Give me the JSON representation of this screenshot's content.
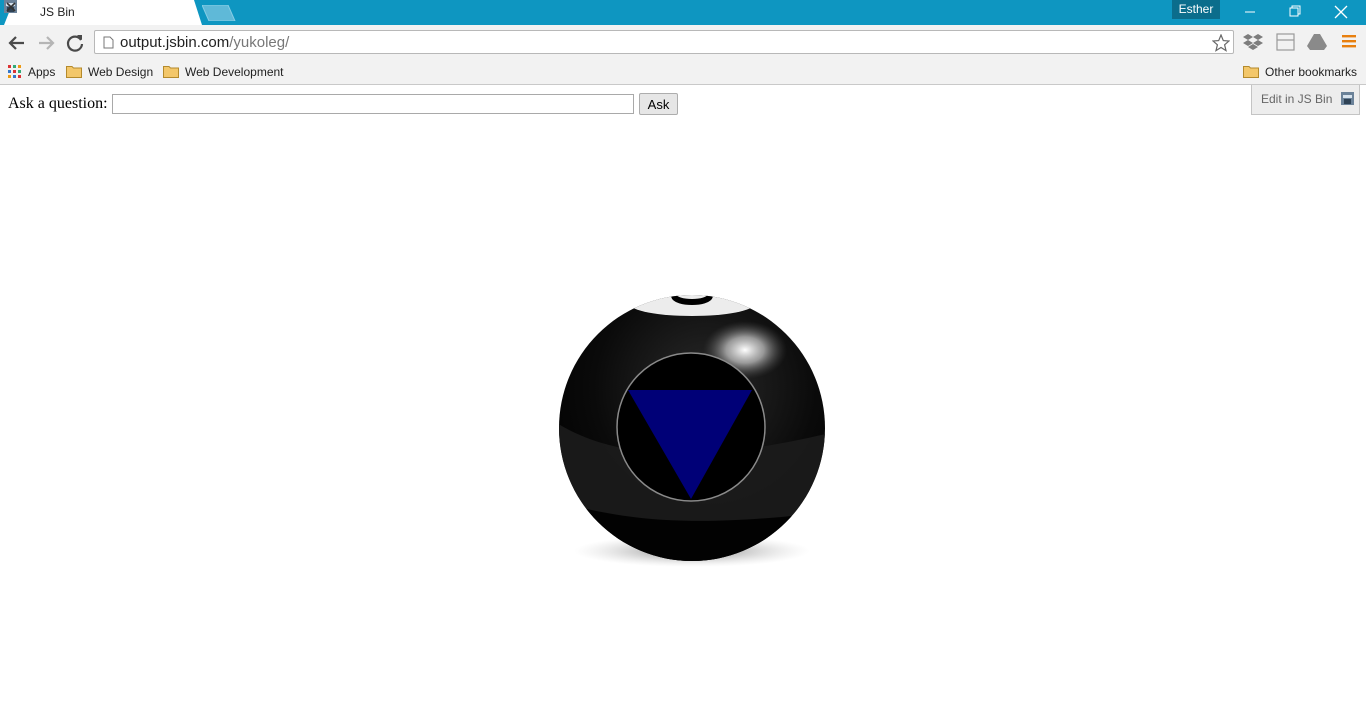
{
  "browser": {
    "tab_title": "JS Bin",
    "profile_name": "Esther",
    "url_host": "output.jsbin.com",
    "url_path": "/yukoleg/",
    "bookmarks": {
      "apps": "Apps",
      "folder1": "Web Design",
      "folder2": "Web Development",
      "other": "Other bookmarks"
    },
    "icons": [
      "back-arrow-icon",
      "forward-arrow-icon",
      "reload-icon",
      "page-icon",
      "star-icon",
      "dropbox-icon",
      "extension-icon",
      "drive-icon",
      "menu-icon",
      "folder-icon",
      "apps-grid-icon",
      "minimize-icon",
      "restore-icon",
      "close-icon"
    ],
    "colors": {
      "titlebar": "#0e96c1",
      "menu_icon": "#e8800f"
    }
  },
  "page": {
    "ask_label": "Ask a question:",
    "ask_placeholder": "",
    "ask_value": "",
    "ask_button": "Ask",
    "edit_link": "Edit in JS Bin",
    "ball_triangle_color": "#000077"
  }
}
